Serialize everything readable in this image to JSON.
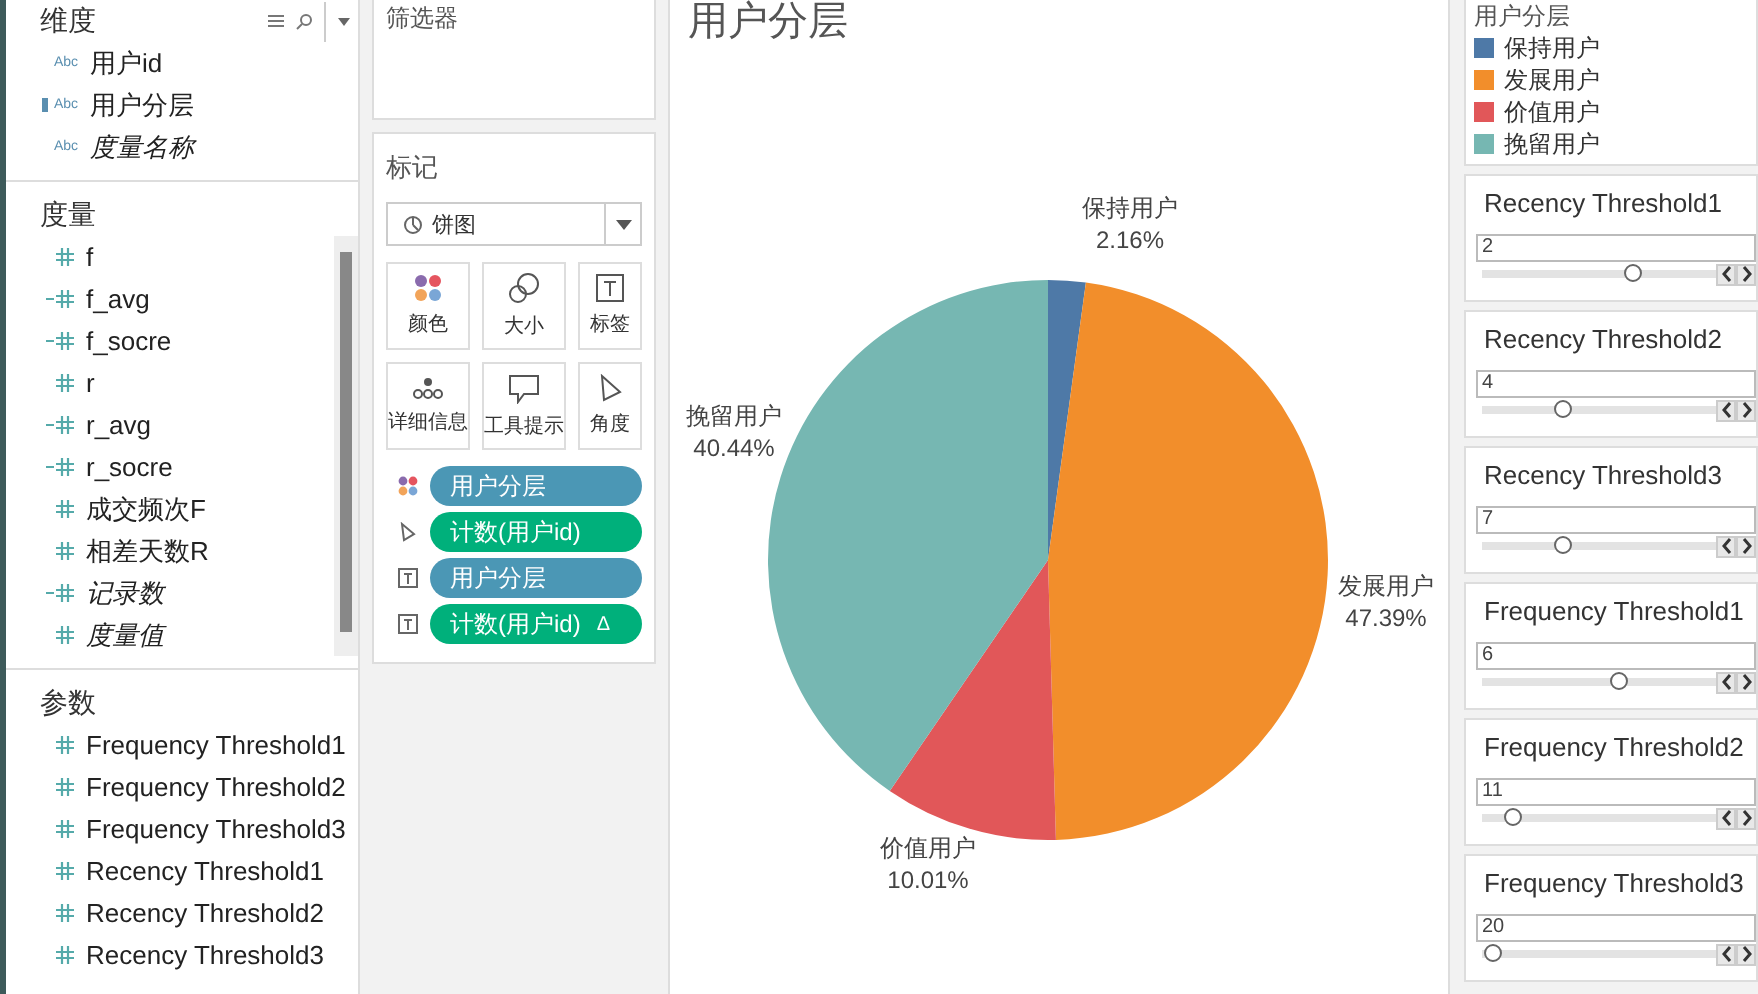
{
  "data_pane": {
    "dimensions": {
      "title": "维度",
      "fields": [
        {
          "type_label": "Abc",
          "calculated": false,
          "name": "用户id",
          "italic": false
        },
        {
          "type_label": "Abc",
          "calculated": true,
          "name": "用户分层",
          "italic": false
        },
        {
          "type_label": "Abc",
          "calculated": false,
          "name": "度量名称",
          "italic": true
        }
      ]
    },
    "measures": {
      "title": "度量",
      "fields": [
        {
          "calculated": false,
          "name": "f",
          "italic": false
        },
        {
          "calculated": true,
          "name": "f_avg",
          "italic": false
        },
        {
          "calculated": true,
          "name": "f_socre",
          "italic": false
        },
        {
          "calculated": false,
          "name": "r",
          "italic": false
        },
        {
          "calculated": true,
          "name": "r_avg",
          "italic": false
        },
        {
          "calculated": true,
          "name": "r_socre",
          "italic": false
        },
        {
          "calculated": false,
          "name": "成交频次F",
          "italic": false
        },
        {
          "calculated": false,
          "name": "相差天数R",
          "italic": false
        },
        {
          "calculated": true,
          "name": "记录数",
          "italic": true
        },
        {
          "calculated": false,
          "name": "度量值",
          "italic": true
        }
      ]
    },
    "parameters": {
      "title": "参数",
      "fields": [
        {
          "name": "Frequency Threshold1"
        },
        {
          "name": "Frequency Threshold2"
        },
        {
          "name": "Frequency Threshold3"
        },
        {
          "name": "Recency Threshold1"
        },
        {
          "name": "Recency Threshold2"
        },
        {
          "name": "Recency Threshold3"
        }
      ]
    }
  },
  "filters": {
    "title": "筛选器"
  },
  "marks": {
    "title": "标记",
    "mark_type": "饼图",
    "buttons": [
      {
        "kind": "color",
        "label": "颜色"
      },
      {
        "kind": "size",
        "label": "大小"
      },
      {
        "kind": "label",
        "label": "标签"
      },
      {
        "kind": "detail",
        "label": "详细信息"
      },
      {
        "kind": "tooltip",
        "label": "工具提示"
      },
      {
        "kind": "angle",
        "label": "角度"
      }
    ],
    "pills": [
      {
        "kind": "color",
        "label": "用户分层",
        "color": "#4b97b5"
      },
      {
        "kind": "angle",
        "label": "计数(用户id)",
        "color": "#00b07b"
      },
      {
        "kind": "label",
        "label": "用户分层",
        "color": "#4b97b5"
      },
      {
        "kind": "label",
        "label": "计数(用户id)",
        "suffix": "Δ",
        "color": "#00b07b"
      }
    ]
  },
  "sheet": {
    "title": "用户分层",
    "chart_data": {
      "type": "pie",
      "categories": [
        "保持用户",
        "发展用户",
        "价值用户",
        "挽留用户"
      ],
      "values": [
        2.16,
        47.39,
        10.01,
        40.44
      ],
      "colors": [
        "#4e79a7",
        "#f28e2b",
        "#e15759",
        "#76b7b2"
      ],
      "value_labels": [
        "2.16%",
        "47.39%",
        "10.01%",
        "40.44%"
      ]
    }
  },
  "legend": {
    "title": "用户分层",
    "items": [
      {
        "label": "保持用户",
        "color": "#4e79a7"
      },
      {
        "label": "发展用户",
        "color": "#f28e2b"
      },
      {
        "label": "价值用户",
        "color": "#e15759"
      },
      {
        "label": "挽留用户",
        "color": "#76b7b2"
      }
    ]
  },
  "parameter_controls": [
    {
      "title": "Recency Threshold1",
      "value": "2",
      "level": 0.64
    },
    {
      "title": "Recency Threshold2",
      "value": "4",
      "level": 0.34
    },
    {
      "title": "Recency Threshold3",
      "value": "7",
      "level": 0.34
    },
    {
      "title": "Frequency Threshold1",
      "value": "6",
      "level": 0.58
    },
    {
      "title": "Frequency Threshold2",
      "value": "11",
      "level": 0.13
    },
    {
      "title": "Frequency Threshold3",
      "value": "20",
      "level": 0.04
    }
  ]
}
